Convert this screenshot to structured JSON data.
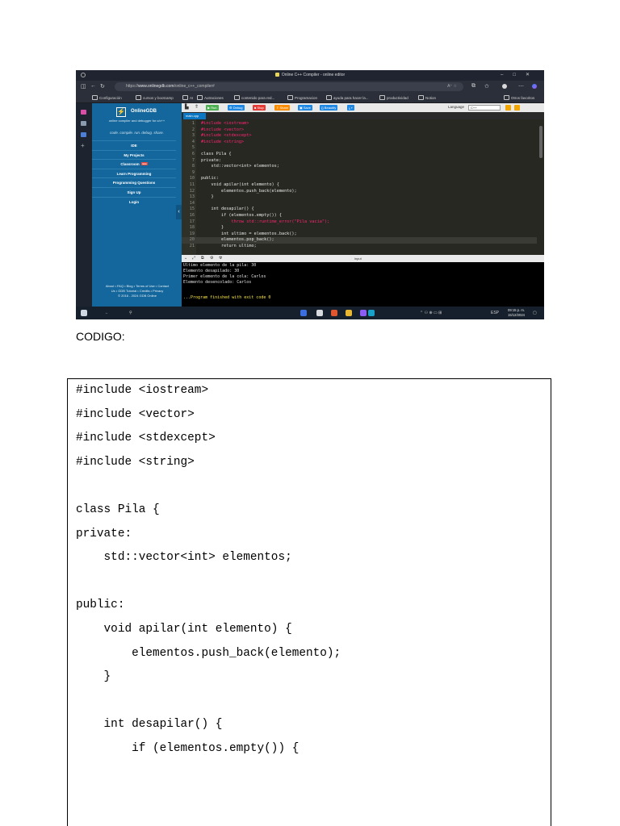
{
  "screenshot": {
    "window_title": "Online C++ Compiler - online editor",
    "url_prefix": "https://",
    "url_domain": "www.onlinegdb.com",
    "url_path": "/online_c++_compiler#",
    "bookmarks": [
      "Configuración",
      "cursos y bootcamp",
      "AI",
      "Autraciones",
      "contenido para red...",
      "Programacion",
      "ayuda para hacer la...",
      "productividad",
      "Notion",
      "Otros favoritos"
    ],
    "brand": "OnlineGDB",
    "tagline": "online compiler and debugger for c/c++",
    "motto": "code. compile. run. debug. share.",
    "menu": [
      "IDE",
      "My Projects",
      "Classroom",
      "Learn Programming",
      "Programming Questions",
      "Sign Up",
      "Login"
    ],
    "new_badge": "new",
    "footer": [
      "About • FAQ • Blog • Terms of Use • Contact",
      "Us • GDB Tutorial • Credits • Privacy",
      "© 2016 - 2024 GDB Online"
    ],
    "toolbar": {
      "run": "Run",
      "debug": "Debug",
      "stop": "Stop",
      "share": "Share",
      "save": "Save",
      "beautify": "Beautify",
      "language_label": "Language",
      "language_value": "C++"
    },
    "file_tab": "main.cpp",
    "io_input_label": "input",
    "editor_lines": [
      {
        "n": "1",
        "code": "#include <iostream>"
      },
      {
        "n": "2",
        "code": "#include <vector>"
      },
      {
        "n": "3",
        "code": "#include <stdexcept>"
      },
      {
        "n": "4",
        "code": "#include <string>"
      },
      {
        "n": "5",
        "code": ""
      },
      {
        "n": "6",
        "code": "class Pila {"
      },
      {
        "n": "7",
        "code": "private:"
      },
      {
        "n": "8",
        "code": "    std::vector<int> elementos;"
      },
      {
        "n": "9",
        "code": ""
      },
      {
        "n": "10",
        "code": "public:"
      },
      {
        "n": "11",
        "code": "    void apilar(int elemento) {"
      },
      {
        "n": "12",
        "code": "        elementos.push_back(elemento);"
      },
      {
        "n": "13",
        "code": "    }"
      },
      {
        "n": "14",
        "code": ""
      },
      {
        "n": "15",
        "code": "    int desapilar() {"
      },
      {
        "n": "16",
        "code": "        if (elementos.empty()) {"
      },
      {
        "n": "17",
        "code": "            throw std::runtime_error(\"Pila vacia\");"
      },
      {
        "n": "18",
        "code": "        }"
      },
      {
        "n": "19",
        "code": "        int ultimo = elementos.back();"
      },
      {
        "n": "20",
        "code": "        elementos.pop_back();"
      },
      {
        "n": "21",
        "code": "        return ultimo;"
      }
    ],
    "console_lines": [
      "Ultimo elemento de la pila: 30",
      "Elemento desapilado: 30",
      "Primer elemento de la cola: Carlos",
      "Elemento desencolado: Carlos"
    ],
    "console_finish": "...Program finished with exit code 0",
    "clock_time": "09:15 p. m.",
    "clock_date": "15/12/2024",
    "tray_lang": "ESP"
  },
  "codigo_label": "CODIGO:",
  "code": [
    "#include <iostream>",
    "#include <vector>",
    "#include <stdexcept>",
    "#include <string>",
    "",
    "class Pila {",
    "private:",
    "    std::vector<int> elementos;",
    "",
    "public:",
    "    void apilar(int elemento) {",
    "        elementos.push_back(elemento);",
    "    }",
    "",
    "    int desapilar() {",
    "        if (elementos.empty()) {"
  ]
}
